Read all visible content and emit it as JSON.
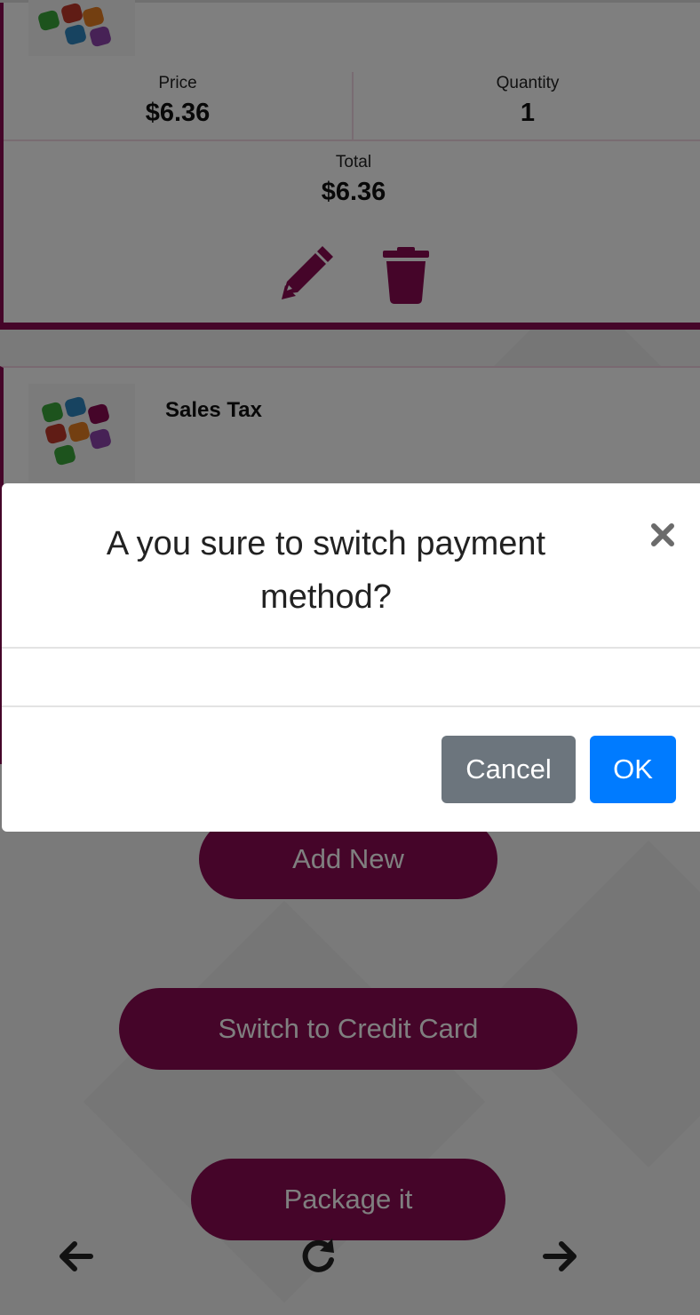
{
  "item": {
    "price_label": "Price",
    "price_value": "$6.36",
    "quantity_label": "Quantity",
    "quantity_value": "1",
    "total_label": "Total",
    "total_value": "$6.36"
  },
  "item2": {
    "title": "Sales Tax"
  },
  "buttons": {
    "add_new": "Add New",
    "switch_payment": "Switch to Credit Card",
    "package": "Package it"
  },
  "modal": {
    "title": "A you sure to switch payment method?",
    "body": "",
    "cancel_label": "Cancel",
    "ok_label": "OK"
  },
  "colors": {
    "accent": "#8b0a53",
    "primary": "#007bff",
    "secondary": "#6c757d"
  },
  "icons": {
    "edit": "pencil-icon",
    "delete": "trash-icon",
    "close": "close-icon",
    "back": "arrow-left-icon",
    "reload": "reload-icon",
    "forward": "arrow-right-icon"
  }
}
